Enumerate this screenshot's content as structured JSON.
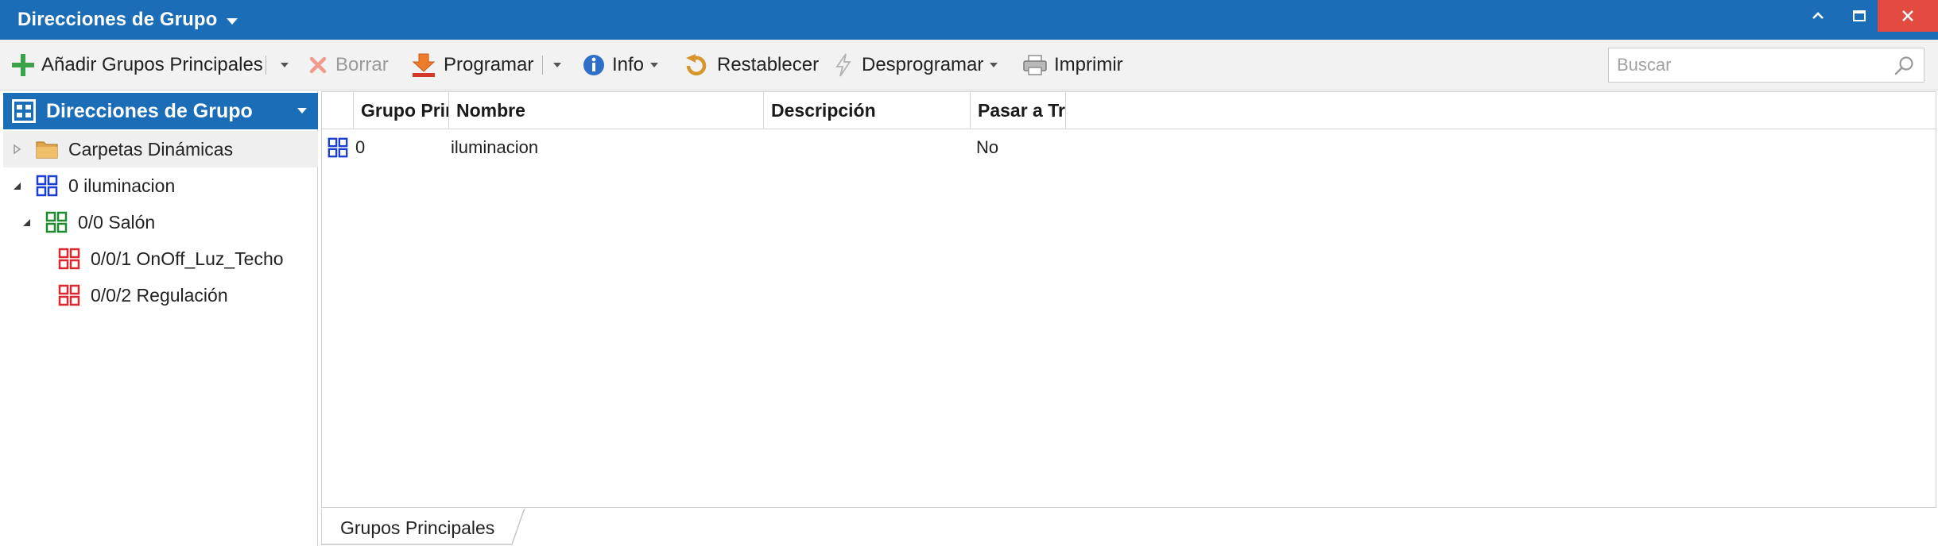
{
  "titlebar": {
    "title": "Direcciones de Grupo",
    "accent_color": "#1b6db8",
    "close_color": "#e24a42"
  },
  "toolbar": {
    "add_main_groups": "Añadir Grupos Principales",
    "delete": "Borrar",
    "program": "Programar",
    "info": "Info",
    "reset": "Restablecer",
    "unprogram": "Desprogramar",
    "print": "Imprimir",
    "icons": [
      "plus-icon",
      "delete-x-icon",
      "download-arrow-icon",
      "info-icon",
      "reset-arrow-icon",
      "lightning-icon",
      "printer-icon"
    ]
  },
  "search": {
    "placeholder": "Buscar",
    "value": ""
  },
  "tree": {
    "header": "Direcciones de Grupo",
    "items": [
      {
        "label": "Carpetas Dinámicas",
        "icon": "folder-icon",
        "expanded": false,
        "selected": true
      },
      {
        "label": "0 iluminacion",
        "icon": "main-group-icon",
        "color": "#1a3fd0",
        "expanded": true
      },
      {
        "label": "0/0 Salón",
        "icon": "middle-group-icon",
        "color": "#1f8a2c",
        "expanded": true
      },
      {
        "label": "0/0/1 OnOff_Luz_Techo",
        "icon": "group-address-icon",
        "color": "#d9282f"
      },
      {
        "label": "0/0/2 Regulación",
        "icon": "group-address-icon",
        "color": "#d9282f"
      }
    ]
  },
  "grid": {
    "columns": [
      "Grupo Principal",
      "Nombre",
      "Descripción",
      "Pasar a Través de Acoplador de Línea"
    ],
    "rows": [
      {
        "icon": "main-group-icon",
        "main_group": "0",
        "name": "iluminacion",
        "description": "",
        "pass_through": "No"
      }
    ]
  },
  "tabs": [
    {
      "label": "Grupos Principales",
      "active": true
    }
  ]
}
